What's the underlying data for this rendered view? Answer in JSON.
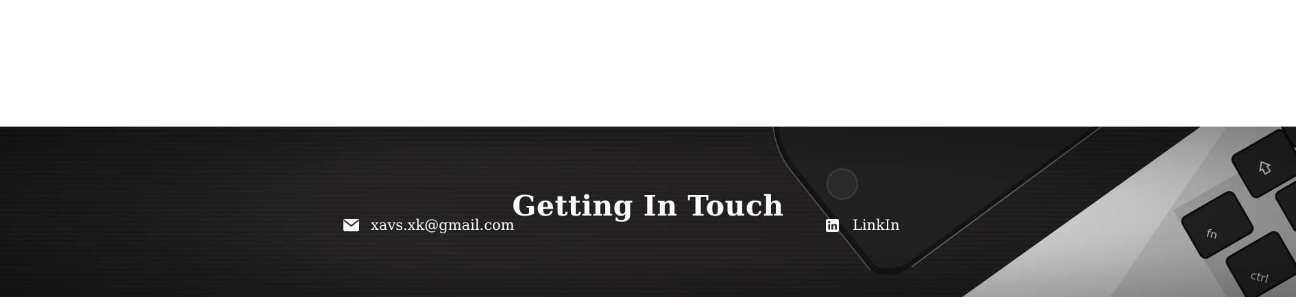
{
  "contact": {
    "title": "Getting In Touch",
    "email": {
      "label": "xavs.xk@gmail.com",
      "icon": "envelope-icon"
    },
    "linkedin": {
      "label": "LinkIn",
      "icon": "linkedin-icon"
    }
  },
  "colors": {
    "background": "#1e1c1c",
    "text": "#ffffff",
    "laptop": "#d4d4d4",
    "phone": "#1a1a1a"
  }
}
